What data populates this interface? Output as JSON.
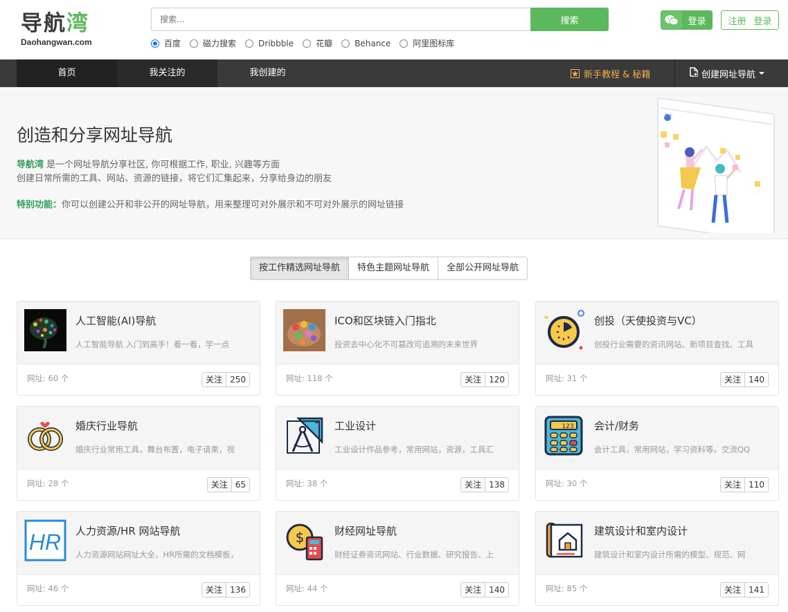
{
  "logo": {
    "cn_a": "导航",
    "cn_b": "湾",
    "en": "Daohangwan.com"
  },
  "search": {
    "placeholder": "搜索...",
    "button": "搜索",
    "engines": [
      "百度",
      "磁力搜索",
      "Dribbble",
      "花瓣",
      "Behance",
      "阿里图标库"
    ],
    "selected": "百度"
  },
  "auth": {
    "wechat_login": "登录",
    "register": "注册",
    "login": "登录"
  },
  "nav": {
    "items": [
      "首页",
      "我关注的",
      "我创建的"
    ],
    "tutorial": "新手教程 & 秘籍",
    "create": "创建网址导航"
  },
  "hero": {
    "title": "创造和分享网址导航",
    "brand": "导航湾",
    "line1_rest": " 是一个网址导航分享社区, 你可根据工作, 职业, 兴趣等方面",
    "line2": "创建日常所需的工具、网站、资源的链接，将它们汇集起来，分享给身边的朋友",
    "feature_label": "特别功能：",
    "feature_text": "你可以创建公开和非公开的网址导航，用来整理可对外展示和不可对外展示的网址链接"
  },
  "tabs": [
    "按工作精选网址导航",
    "特色主题网址导航",
    "全部公开网址导航"
  ],
  "follow_label": "关注",
  "cards": [
    {
      "title": "人工智能(AI)导航",
      "desc": "人工智能导航 入门到高手！看一看，学一点",
      "count": "网址: 60 个",
      "follows": "250",
      "icon": "ai-brain-icon"
    },
    {
      "title": "ICO和区块链入门指北",
      "desc": "投资去中心化不可篡改可追溯的未来世界",
      "count": "网址: 118 个",
      "follows": "120",
      "icon": "blockchain-icon"
    },
    {
      "title": "创投（天使投资与VC）",
      "desc": "创投行业需要的资讯网站、新项目查找、工具",
      "count": "网址: 31 个",
      "follows": "140",
      "icon": "timer-icon"
    },
    {
      "title": "婚庆行业导航",
      "desc": "婚庆行业常用工具，舞台布置，电子请柬，视",
      "count": "网址: 28 个",
      "follows": "65",
      "icon": "wedding-rings-icon"
    },
    {
      "title": "工业设计",
      "desc": "工业设计作品参考，常用网站，资源，工具汇",
      "count": "网址: 38 个",
      "follows": "138",
      "icon": "compass-ruler-icon"
    },
    {
      "title": "会计/财务",
      "desc": "会计工具，常用网站，学习资料等。交流QQ",
      "count": "网址: 30 个",
      "follows": "110",
      "icon": "calculator-icon"
    },
    {
      "title": "人力资源/HR 网站导航",
      "desc": "人力资源网站网址大全，HR所需的文档模板，",
      "count": "网址: 46 个",
      "follows": "136",
      "icon": "hr-icon"
    },
    {
      "title": "财经网址导航",
      "desc": "财经证券资讯网站、行业数据、研究报告、上",
      "count": "网址: 44 个",
      "follows": "140",
      "icon": "finance-coin-icon"
    },
    {
      "title": "建筑设计和室内设计",
      "desc": "建筑设计和室内设计所需的模型、规范、网",
      "count": "网址: 85 个",
      "follows": "141",
      "icon": "blueprint-house-icon"
    }
  ]
}
